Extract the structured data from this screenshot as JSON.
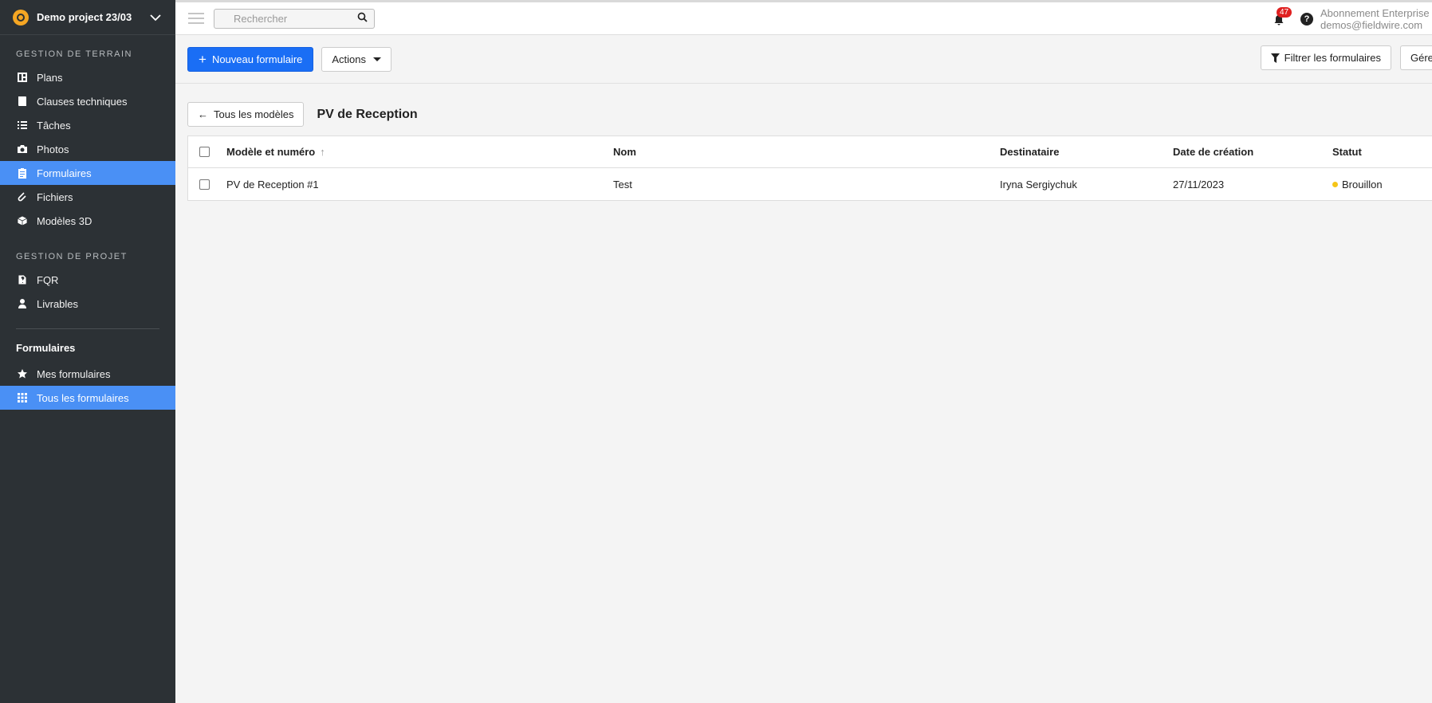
{
  "sidebar": {
    "project_name": "Demo project 23/03",
    "sections": [
      {
        "title": "Gestion de terrain",
        "items": [
          {
            "label": "Plans",
            "icon": "plans-icon"
          },
          {
            "label": "Clauses techniques",
            "icon": "specifications-icon"
          },
          {
            "label": "Tâches",
            "icon": "list-icon"
          },
          {
            "label": "Photos",
            "icon": "camera-icon"
          },
          {
            "label": "Formulaires",
            "icon": "clipboard-icon",
            "active": true
          },
          {
            "label": "Fichiers",
            "icon": "paperclip-icon"
          },
          {
            "label": "Modèles 3D",
            "icon": "cube-icon"
          }
        ]
      },
      {
        "title": "Gestion de projet",
        "items": [
          {
            "label": "FQR",
            "icon": "file-question-icon"
          },
          {
            "label": "Livrables",
            "icon": "submittal-icon"
          }
        ]
      }
    ],
    "forms_section": {
      "title": "Formulaires",
      "items": [
        {
          "label": "Mes formulaires",
          "icon": "star-icon"
        },
        {
          "label": "Tous les formulaires",
          "icon": "grid-icon",
          "active": true
        }
      ]
    }
  },
  "topbar": {
    "search_placeholder": "Rechercher",
    "notification_count": "47",
    "help_label": "?",
    "account_plan": "Abonnement Enterprise",
    "account_email": "demos@fieldwire.com"
  },
  "toolbar": {
    "new_form_label": "Nouveau formulaire",
    "actions_label": "Actions",
    "filter_label": "Filtrer les formulaires",
    "manage_label_partial": "Gére"
  },
  "subheader": {
    "back_label": "Tous les modèles",
    "title": "PV de Reception"
  },
  "table": {
    "columns": [
      "Modèle et numéro",
      "Nom",
      "Destinataire",
      "Date de création",
      "Statut"
    ],
    "rows": [
      {
        "model_number": "PV de Reception #1",
        "name": "Test",
        "recipient": "Iryna Sergiychuk",
        "created": "27/11/2023",
        "status": "Brouillon",
        "status_color": "#f5c518"
      }
    ]
  },
  "colors": {
    "sidebar_bg": "#2c3135",
    "active_item": "#4a90f5",
    "primary_button": "#1a6ef5",
    "badge": "#e02020"
  }
}
